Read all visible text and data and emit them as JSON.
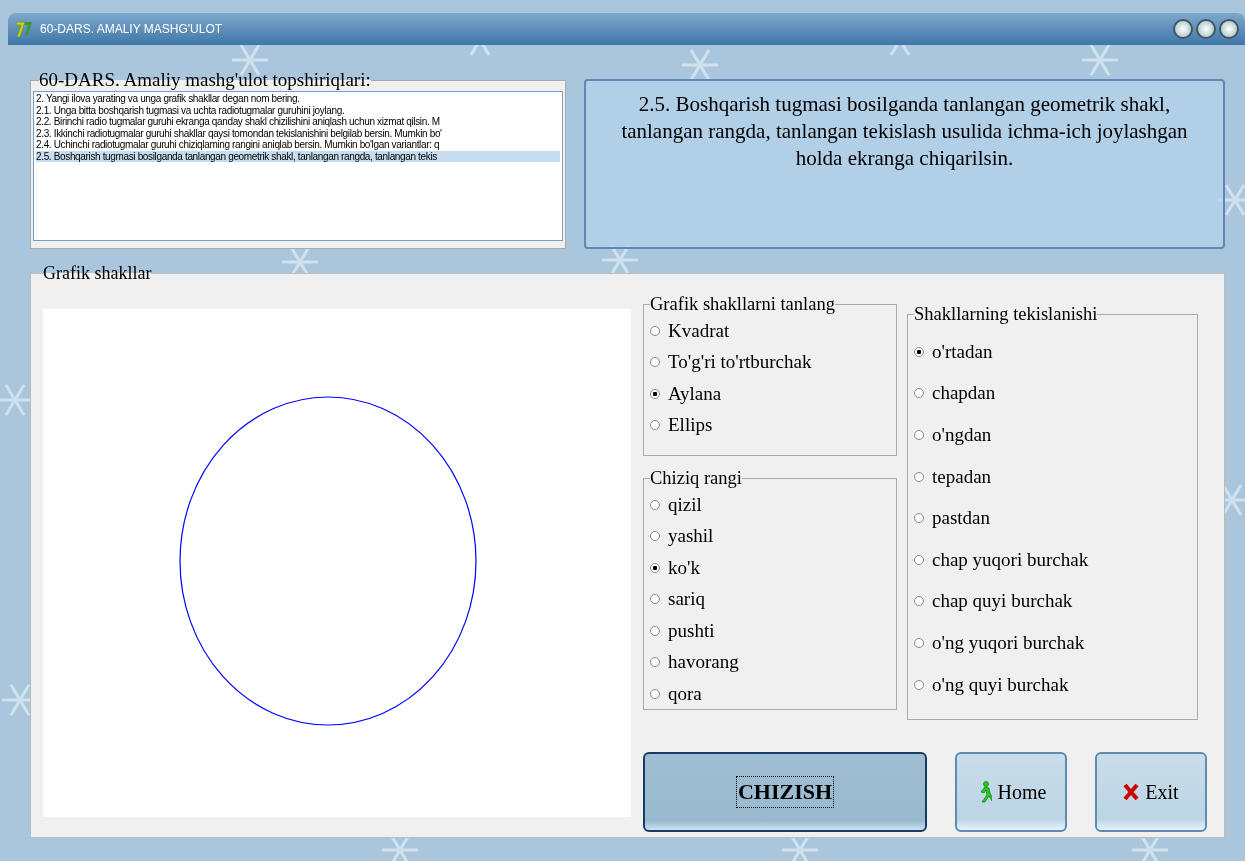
{
  "window": {
    "title": "60-DARS. AMALIY MASHG'ULOT"
  },
  "tasks": {
    "legend": "60-DARS. Amaliy mashg'ulot topshiriqlari:",
    "items": [
      {
        "text": "2. Yangi ilova yarating va unga grafik shakllar degan nom bering.",
        "selected": false
      },
      {
        "text": "2.1. Unga bitta boshqarish tugmasi va uchta radiotugmalar guruhini joylang.",
        "selected": false
      },
      {
        "text": "2.2. Birinchi radio tugmalar guruhi ekranga qanday shakl chizilishini aniqlash uchun xizmat qilsin. M",
        "selected": false
      },
      {
        "text": "2.3. Ikkinchi radiotugmalar guruhi shakllar qaysi tomondan tekislanishini belgilab bersin. Mumkin bo'",
        "selected": false
      },
      {
        "text": "2.4. Uchinchi radiotugmalar guruhi chiziqlaming rangini aniqlab bersin. Mumkin bo'lgan variantlar: q",
        "selected": false
      },
      {
        "text": "2.5. Boshqarish tugmasi bosilganda tanlangan geometrik shakl, tanlangan rangda, tanlangan tekis",
        "selected": true
      }
    ]
  },
  "task_detail": "2.5. Boshqarish tugmasi bosilganda tanlangan geometrik shakl, tanlangan rangda, tanlangan tekislash usulida ichma-ich joylashgan holda ekranga chiqarilsin.",
  "panel": {
    "legend": "Grafik shakllar",
    "shapes": {
      "legend": "Grafik shakllarni tanlang",
      "options": [
        {
          "label": "Kvadrat",
          "selected": false
        },
        {
          "label": "To'g'ri to'rtburchak",
          "selected": false
        },
        {
          "label": "Aylana",
          "selected": true
        },
        {
          "label": "Ellips",
          "selected": false
        }
      ]
    },
    "colors": {
      "legend": "Chiziq rangi",
      "options": [
        {
          "label": "qizil",
          "selected": false
        },
        {
          "label": "yashil",
          "selected": false
        },
        {
          "label": "ko'k",
          "selected": true
        },
        {
          "label": "sariq",
          "selected": false
        },
        {
          "label": "pushti",
          "selected": false
        },
        {
          "label": "havorang",
          "selected": false
        },
        {
          "label": "qora",
          "selected": false
        }
      ]
    },
    "alignment": {
      "legend": "Shakllarning tekislanishi",
      "options": [
        {
          "label": "o'rtadan",
          "selected": true
        },
        {
          "label": "chapdan",
          "selected": false
        },
        {
          "label": "o'ngdan",
          "selected": false
        },
        {
          "label": "tepadan",
          "selected": false
        },
        {
          "label": "pastdan",
          "selected": false
        },
        {
          "label": "chap yuqori burchak",
          "selected": false
        },
        {
          "label": "chap quyi burchak",
          "selected": false
        },
        {
          "label": "o'ng yuqori burchak",
          "selected": false
        },
        {
          "label": "o'ng quyi burchak",
          "selected": false
        }
      ]
    },
    "buttons": [
      {
        "label": "CHIZISH",
        "kind": "draw"
      },
      {
        "label": "Home",
        "kind": "home"
      },
      {
        "label": "Exit",
        "kind": "exit"
      }
    ]
  }
}
